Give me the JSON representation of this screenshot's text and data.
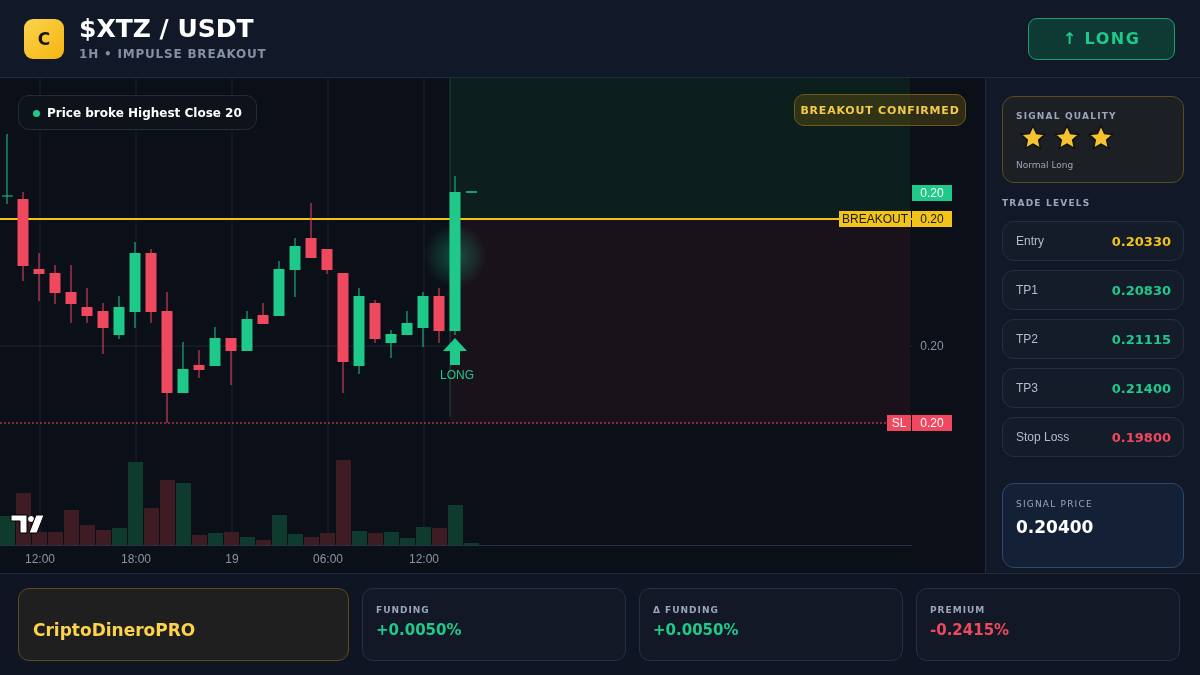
{
  "header": {
    "logo_letter": "C",
    "title": "$XTZ / USDT",
    "subtitle": "1H • IMPULSE BREAKOUT",
    "direction_button": {
      "icon": "↑",
      "label": "LONG"
    }
  },
  "chart": {
    "alert": "Price broke Highest Close 20",
    "status_badge": "BREAKOUT CONFIRMED",
    "signal_marker": "LONG",
    "price_labels": [
      {
        "kind": "target",
        "value": "0.20"
      },
      {
        "kind": "breakout",
        "tag": "BREAKOUT",
        "value": "0.20"
      },
      {
        "kind": "grid",
        "value": "0.20"
      },
      {
        "kind": "stop",
        "tag": "SL",
        "value": "0.20"
      }
    ],
    "time_labels": [
      "12:00",
      "18:00",
      "19",
      "06:00",
      "12:00"
    ]
  },
  "sidebar": {
    "signal_quality": {
      "label": "SIGNAL QUALITY",
      "stars": 3,
      "caption": "Normal Long"
    },
    "trade_levels_title": "TRADE LEVELS",
    "levels": [
      {
        "label": "Entry",
        "value": "0.20330",
        "kind": "entry"
      },
      {
        "label": "TP1",
        "value": "0.20830",
        "kind": "target"
      },
      {
        "label": "TP2",
        "value": "0.21115",
        "kind": "target"
      },
      {
        "label": "TP3",
        "value": "0.21400",
        "kind": "target"
      },
      {
        "label": "Stop Loss",
        "value": "0.19800",
        "kind": "stop"
      }
    ],
    "signal_price": {
      "label": "SIGNAL PRICE",
      "value": "0.20400"
    }
  },
  "footer": {
    "brand": "CriptoDineroPRO",
    "stats": [
      {
        "label": "FUNDING",
        "value": "+0.0050%",
        "kind": "positive"
      },
      {
        "label": "Δ FUNDING",
        "value": "+0.0050%",
        "kind": "positive"
      },
      {
        "label": "PREMIUM",
        "value": "-0.2415%",
        "kind": "negative"
      }
    ]
  }
}
